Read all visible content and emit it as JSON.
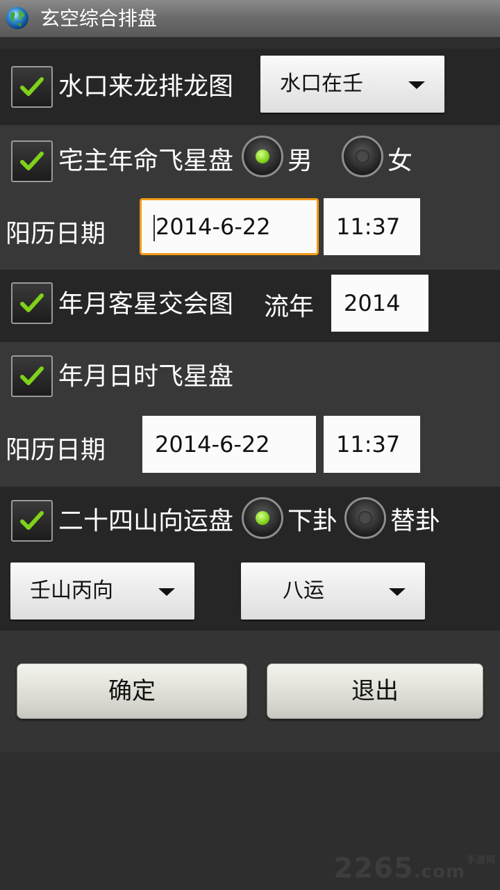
{
  "app": {
    "title": "玄空综合排盘",
    "globe_icon": "globe-icon"
  },
  "colors": {
    "check_green": "#7fd21a",
    "focus_orange": "#f39a16"
  },
  "shuikou": {
    "checked": true,
    "label": "水口来龙排龙图",
    "spinner_value": "水口在壬"
  },
  "zhaizhu": {
    "checked": true,
    "label": "宅主年命飞星盘",
    "gender_male": "男",
    "gender_female": "女",
    "selected_gender": "男",
    "date_label": "阳历日期",
    "date_value": "2014-6-22",
    "time_value": "11:37"
  },
  "nianyue": {
    "checked": true,
    "label": "年月客星交会图",
    "liunian_label": "流年",
    "liunian_value": "2014"
  },
  "nianyueri": {
    "checked": true,
    "label": "年月日时飞星盘",
    "date_label": "阳历日期",
    "date_value": "2014-6-22",
    "time_value": "11:37"
  },
  "ershisi": {
    "checked": true,
    "label": "二十四山向运盘",
    "option_xiagua": "下卦",
    "option_tigua": "替卦",
    "selected_option": "下卦",
    "shan_value": "壬山丙向",
    "yun_value": "八运"
  },
  "buttons": {
    "confirm": "确定",
    "exit": "退出"
  },
  "watermark": {
    "main": "2265",
    "suffix": ".com",
    "small": "手游网"
  }
}
